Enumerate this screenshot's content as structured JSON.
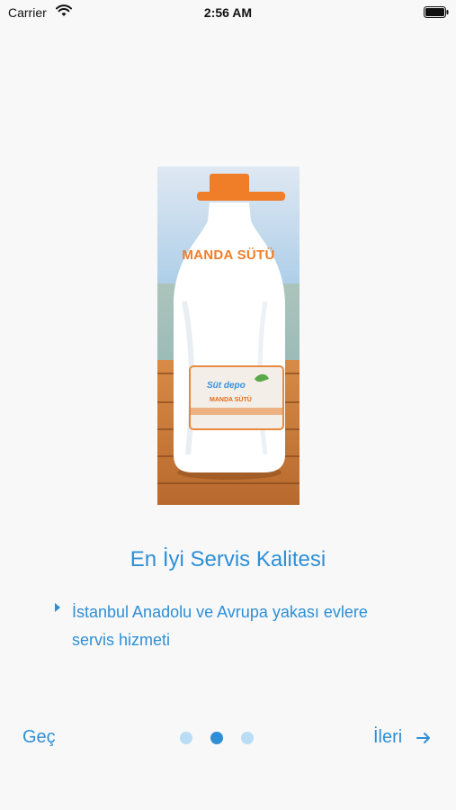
{
  "status_bar": {
    "carrier": "Carrier",
    "time": "2:56 AM"
  },
  "product_image": {
    "title_text": "MANDA SÜTÜ",
    "label_brand": "Süt depo",
    "label_product": "MANDA SÜTÜ"
  },
  "slide": {
    "title": "En İyi Servis Kalitesi",
    "bullet": "İstanbul Anadolu ve Avrupa yakası evlere servis hizmeti"
  },
  "footer": {
    "skip_label": "Geç",
    "next_label": "İleri",
    "page_count": 3,
    "current_page": 2
  },
  "colors": {
    "accent": "#2e8fd6",
    "dot_inactive": "#b8ddf4",
    "background": "#f8f8f9",
    "cap_orange": "#f07d28"
  },
  "icons": {
    "wifi": "wifi-icon",
    "battery": "battery-icon",
    "bullet": "bullet-triangle-icon",
    "next": "arrow-right-icon"
  }
}
